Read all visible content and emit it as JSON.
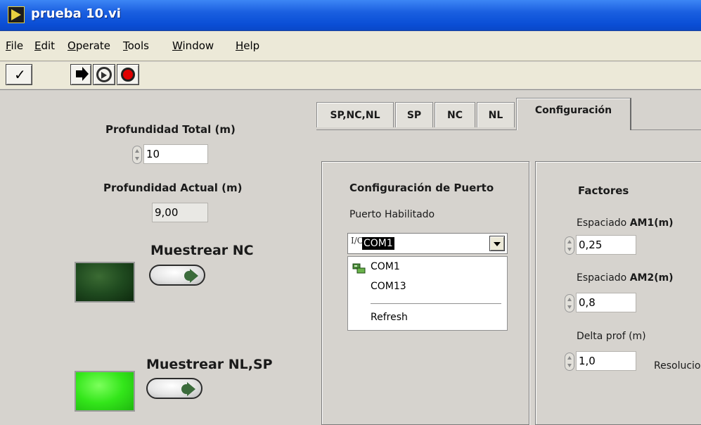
{
  "window": {
    "title": "prueba 10.vi"
  },
  "menu": {
    "items": [
      {
        "mnemonic": "F",
        "rest": "ile"
      },
      {
        "mnemonic": "E",
        "rest": "dit"
      },
      {
        "mnemonic": "O",
        "rest": "perate"
      },
      {
        "mnemonic": "T",
        "rest": "ools"
      },
      {
        "mnemonic": "W",
        "rest": "indow"
      },
      {
        "mnemonic": "H",
        "rest": "elp"
      }
    ]
  },
  "left": {
    "profundidad_total_label": "Profundidad Total (m)",
    "profundidad_total_value": "10",
    "profundidad_actual_label": "Profundidad Actual (m)",
    "profundidad_actual_value": "9,00",
    "muestrear_nc_label": "Muestrear NC",
    "muestrear_nlsp_label": "Muestrear NL,SP",
    "led_nc_color": "#1f4a1f",
    "led_nlsp_color": "#33e61a"
  },
  "tabs": [
    "SP,NC,NL",
    "SP",
    "NC",
    "NL",
    "Configuración"
  ],
  "active_tab": "Configuración",
  "port_config": {
    "title": "Configuración de Puerto",
    "port_label": "Puerto Habilitado",
    "io_glyph": "I/O",
    "selected": "COM1",
    "options": [
      "COM1",
      "COM13"
    ],
    "refresh": "Refresh"
  },
  "factors": {
    "title": "Factores",
    "am1_prefix": "Espaciado ",
    "am1_bold": "AM1(m)",
    "am1_value": "0,25",
    "am2_prefix": "Espaciado ",
    "am2_bold": "AM2(m)",
    "am2_value": "0,8",
    "delta_label": "Delta prof (m)",
    "delta_value": "1,0",
    "resolucion_label": "Resolucio"
  }
}
